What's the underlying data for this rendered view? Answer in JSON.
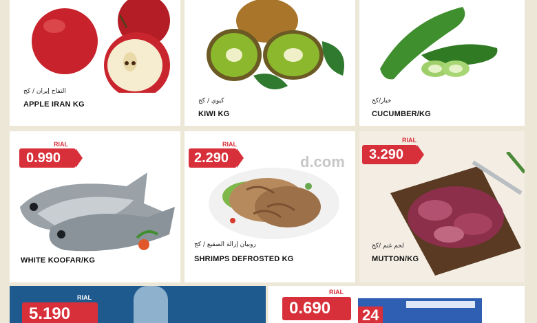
{
  "products": [
    {
      "id": "apple",
      "name_en": "APPLE IRAN KG",
      "name_ar": "التفاح إيران / كج"
    },
    {
      "id": "kiwi",
      "name_en": "KIWI KG",
      "name_ar": "كيوي / كج"
    },
    {
      "id": "cucumber",
      "name_en": "CUCUMBER/KG",
      "name_ar": "خيار/كج"
    },
    {
      "id": "koofar",
      "name_en": "WHITE KOOFAR/KG",
      "currency": "RIAL",
      "price": "0.990"
    },
    {
      "id": "shrimps",
      "name_en": "SHRIMPS DEFROSTED KG",
      "name_ar": "روبيان إزالة الصقيع / كج",
      "currency": "RIAL",
      "price": "2.290"
    },
    {
      "id": "mutton",
      "name_en": "MUTTON/KG",
      "name_ar": "لحم غنم /كج",
      "currency": "RIAL",
      "price": "3.290"
    },
    {
      "id": "water",
      "currency": "RIAL",
      "price": "5.190"
    },
    {
      "id": "milk",
      "currency": "RIAL",
      "price": "0.690",
      "badge": "24"
    }
  ],
  "colors": {
    "price_tag": "#d8303a",
    "background": "#ece7d6"
  },
  "watermark": "d.com"
}
